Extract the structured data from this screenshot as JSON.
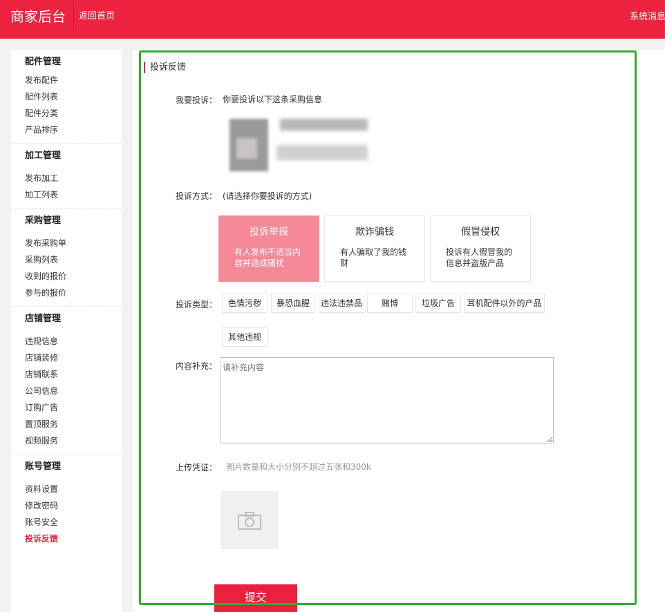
{
  "header": {
    "brand": "商家后台",
    "home_link": "返回首页",
    "messages_link": "系统消息"
  },
  "sidebar": {
    "groups": [
      {
        "title": "配件管理",
        "items": [
          "发布配件",
          "配件列表",
          "配件分类",
          "产品排序"
        ]
      },
      {
        "title": "加工管理",
        "items": [
          "发布加工",
          "加工列表"
        ]
      },
      {
        "title": "采购管理",
        "items": [
          "发布采购单",
          "采购列表",
          "收到的报价",
          "参与的报价"
        ]
      },
      {
        "title": "店铺管理",
        "items": [
          "违规信息",
          "店铺装修",
          "店铺联系",
          "公司信息",
          "订购广告",
          "置顶服务",
          "视频服务"
        ]
      },
      {
        "title": "账号管理",
        "items": [
          "资料设置",
          "修改密码",
          "账号安全",
          "投诉反馈"
        ]
      }
    ],
    "active_item": "投诉反馈"
  },
  "form": {
    "title": "投诉反馈",
    "target_label": "我要投诉：",
    "target_text": "你要投诉以下这条采购信息",
    "method_label": "投诉方式：",
    "method_hint": "(请选择你要投诉的方式)",
    "methods": [
      {
        "title": "投诉举报",
        "desc": "有人发布不适当内容并造成骚扰",
        "selected": true
      },
      {
        "title": "欺诈骗钱",
        "desc": "有人骗取了我的钱财",
        "selected": false
      },
      {
        "title": "假冒侵权",
        "desc": "投诉有人假冒我的信息并盗版产品",
        "selected": false
      }
    ],
    "type_label": "投诉类型：",
    "types": [
      "色情污秽",
      "暴恐血腥",
      "违法违禁品",
      "赌博",
      "垃圾广告",
      "耳机配件以外的产品",
      "其他违规"
    ],
    "content_label": "内容补充：",
    "content_placeholder": "请补充内容",
    "upload_label": "上传凭证：",
    "upload_hint": "图片数量和大小分别不超过五张和300k",
    "submit_label": "提交"
  },
  "colors": {
    "brand_red": "#ee2340",
    "selected_card": "#f48a98",
    "highlight_border": "#2eac2e"
  },
  "icons": {
    "upload": "camera-icon"
  }
}
